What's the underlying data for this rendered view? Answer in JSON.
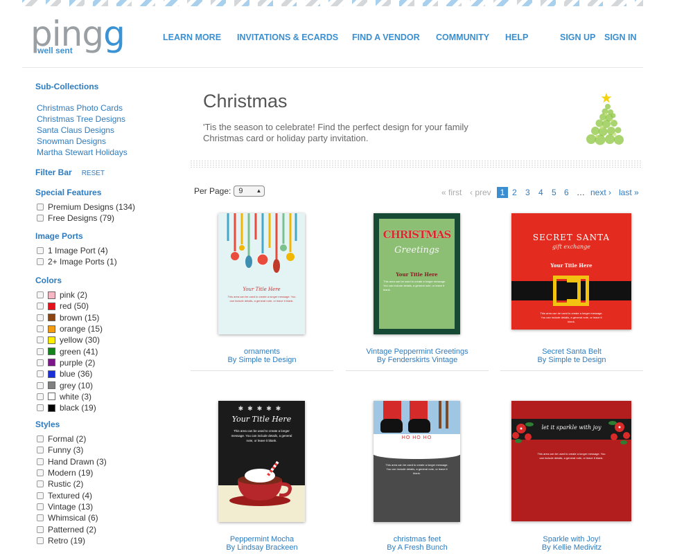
{
  "logo": {
    "word": "pingg",
    "tagline": "well sent"
  },
  "nav": {
    "learn_more": "LEARN MORE",
    "invitations": "INVITATIONS & ECARDS",
    "find_vendor": "FIND A VENDOR",
    "community": "COMMUNITY",
    "help": "HELP",
    "sign_up": "SIGN UP",
    "sign_in": "SIGN IN"
  },
  "sidebar": {
    "subcollections_heading": "Sub-Collections",
    "subcollections": [
      "Christmas Photo Cards",
      "Christmas Tree Designs",
      "Santa Claus Designs",
      "Snowman Designs",
      "Martha Stewart Holidays"
    ],
    "filter_heading": "Filter Bar",
    "reset": "RESET",
    "special_heading": "Special Features",
    "special": [
      "Premium Designs (134)",
      "Free Designs (79)"
    ],
    "ports_heading": "Image Ports",
    "ports": [
      "1 Image Port (4)",
      "2+ Image Ports (1)"
    ],
    "colors_heading": "Colors",
    "colors": [
      {
        "label": "pink (2)",
        "hex": "#f7b6c3"
      },
      {
        "label": "red (50)",
        "hex": "#e4111b"
      },
      {
        "label": "brown (15)",
        "hex": "#8b4513"
      },
      {
        "label": "orange (15)",
        "hex": "#f39c12"
      },
      {
        "label": "yellow (30)",
        "hex": "#ffee00"
      },
      {
        "label": "green (41)",
        "hex": "#15821c"
      },
      {
        "label": "purple (2)",
        "hex": "#7b1589"
      },
      {
        "label": "blue (36)",
        "hex": "#1a2fd6"
      },
      {
        "label": "grey (10)",
        "hex": "#808080"
      },
      {
        "label": "white (3)",
        "hex": "#ffffff"
      },
      {
        "label": "black (19)",
        "hex": "#000000"
      }
    ],
    "styles_heading": "Styles",
    "styles": [
      "Formal (2)",
      "Funny (3)",
      "Hand Drawn (3)",
      "Modern (19)",
      "Rustic (2)",
      "Textured (4)",
      "Vintage (13)",
      "Whimsical (6)",
      "Patterned (2)",
      "Retro (19)"
    ]
  },
  "main": {
    "title": "Christmas",
    "description": "'Tis the season to celebrate! Find the perfect design for your family Christmas card or holiday party invitation.",
    "per_page_label": "Per Page:",
    "per_page_value": "9",
    "pager": {
      "first": "« first",
      "prev": "‹ prev",
      "pages": [
        "1",
        "2",
        "3",
        "4",
        "5",
        "6"
      ],
      "ellipsis": "…",
      "next": "next ›",
      "last": "last »"
    }
  },
  "cards": [
    {
      "name": "ornaments",
      "by": "By Simple te Design",
      "text_title": "Your Title Here",
      "text_body": "This area can be used to create a longer message. You can include details, a general note, or leave it blank."
    },
    {
      "name": "Vintage Peppermint Greetings",
      "by": "By Fenderskirts Vintage",
      "text_title": "Your Title Here",
      "text_body": "This area can be used to create a longer message. You can include details, a general note, or leave it blank.",
      "art1": "CHRISTMAS",
      "art2": "Greetings"
    },
    {
      "name": "Secret Santa Belt",
      "by": "By Simple te Design",
      "text_title": "Your Title Here",
      "text_body": "This area can be used to create a longer message. You can include details, a general note, or leave it blank.",
      "art1": "SECRET SANTA",
      "art2": "gift exchange"
    },
    {
      "name": "Peppermint Mocha",
      "by": "By Lindsay Brackeen",
      "text_title": "Your Title Here",
      "text_body": "This area can be used to create a longer message. You can include details, a general note, or leave it blank."
    },
    {
      "name": "christmas feet",
      "by": "By A Fresh Bunch",
      "text_title": "HO HO HO",
      "text_body": "This area can be used to create a longer message. You can include details, a general note, or leave it blank."
    },
    {
      "name": "Sparkle with Joy!",
      "by": "By Kellie Medivitz",
      "text_title": "let it sparkle with joy",
      "text_body": "This area can be used to create a longer message. You can include details, a general note, or leave it blank."
    }
  ]
}
